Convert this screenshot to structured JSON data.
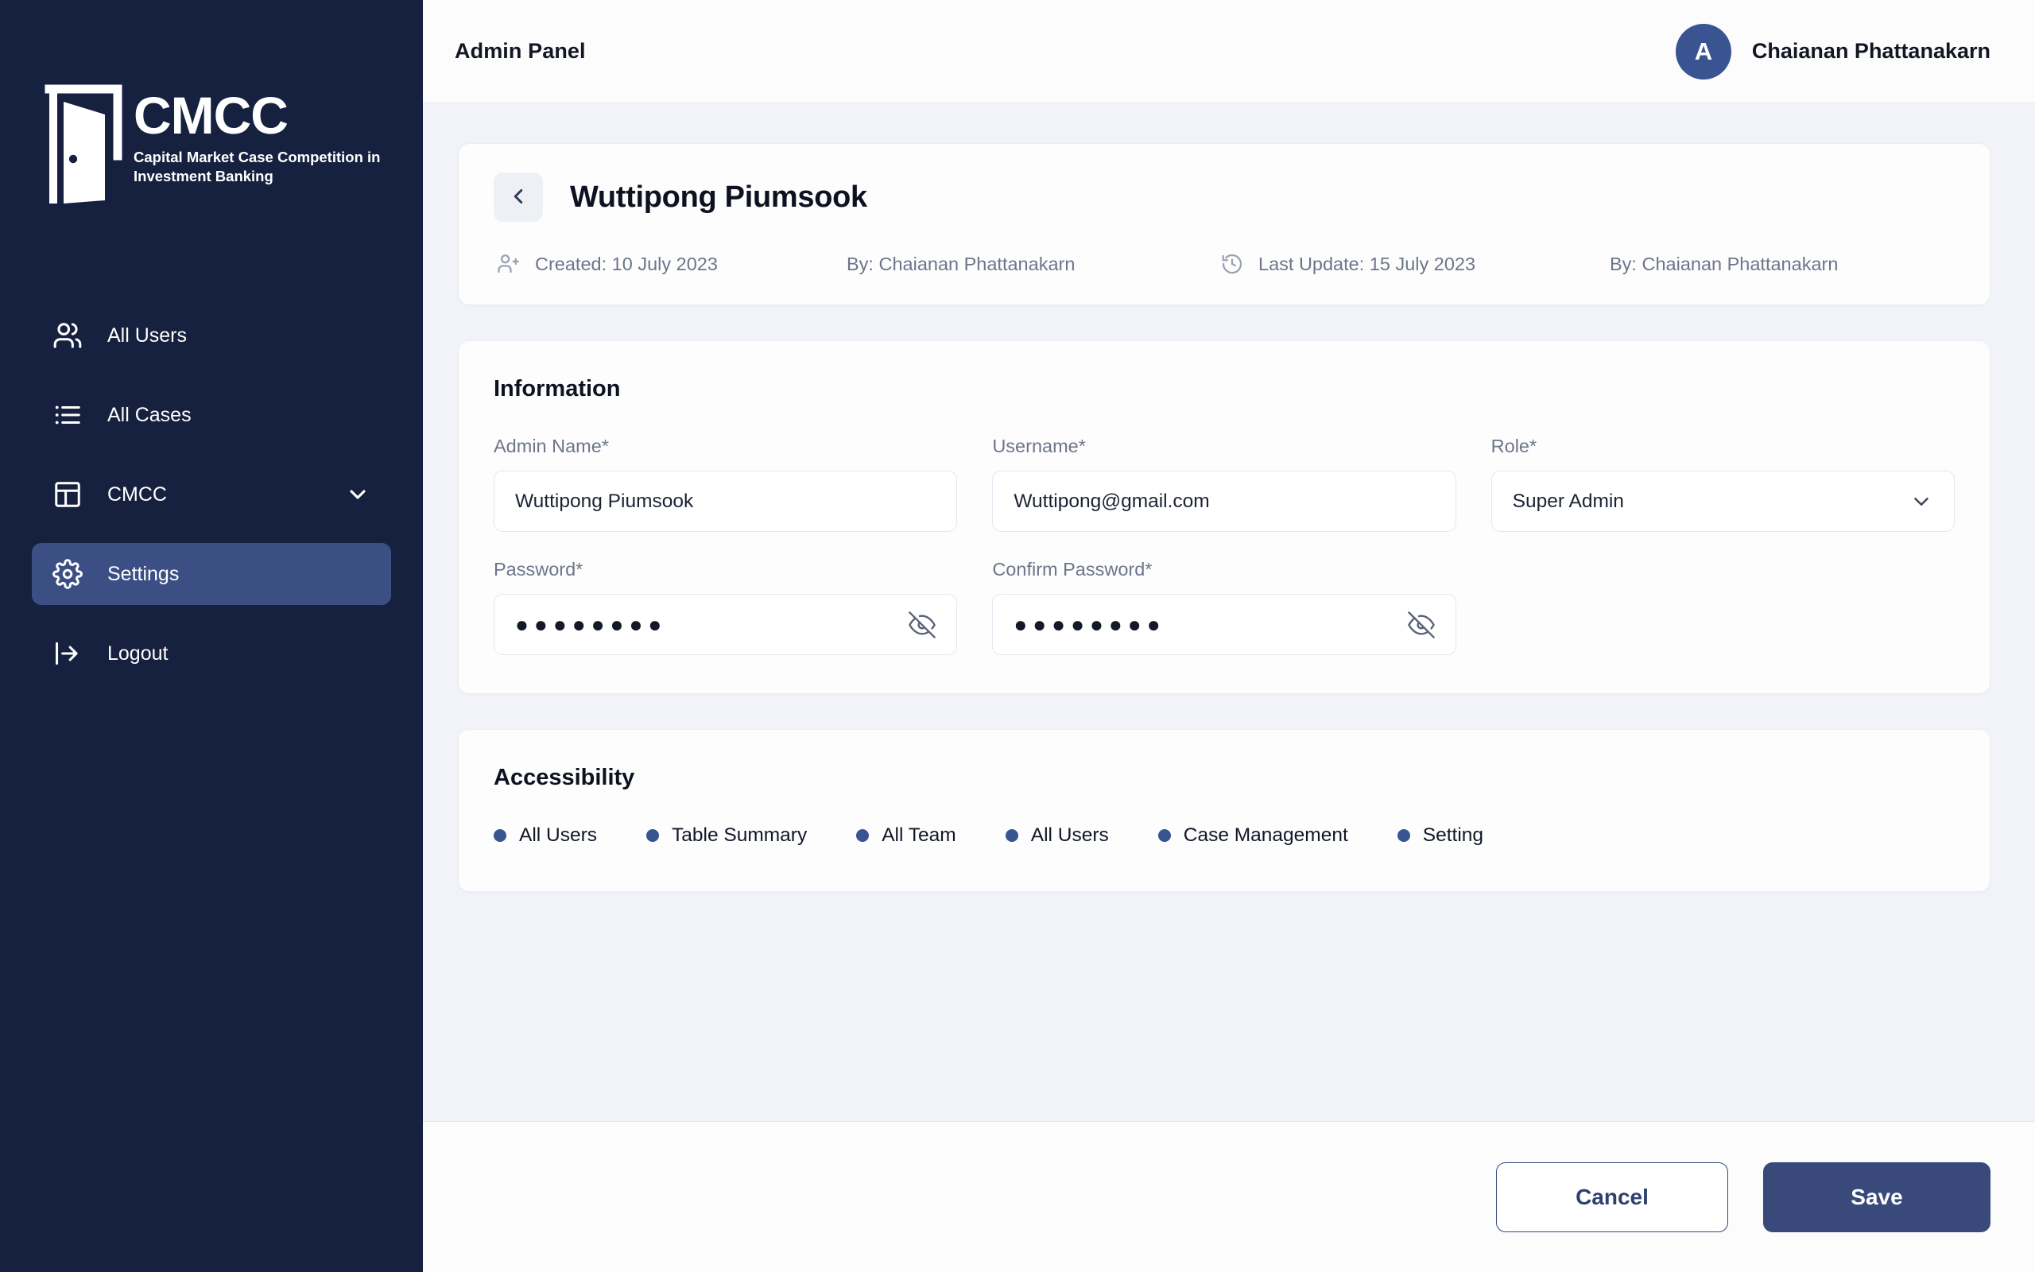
{
  "sidebar": {
    "logo": {
      "icon": "open-door-icon",
      "title": "CMCC",
      "subtitle": "Capital Market Case Competition in Investment Banking"
    },
    "items": [
      {
        "label": "All Users",
        "icon": "users-icon",
        "active": false,
        "has_chevron": false
      },
      {
        "label": "All Cases",
        "icon": "list-icon",
        "active": false,
        "has_chevron": false
      },
      {
        "label": "CMCC",
        "icon": "layout-icon",
        "active": false,
        "has_chevron": true
      },
      {
        "label": "Settings",
        "icon": "gear-icon",
        "active": true,
        "has_chevron": false
      },
      {
        "label": "Logout",
        "icon": "logout-icon",
        "active": false,
        "has_chevron": false
      }
    ]
  },
  "topbar": {
    "title": "Admin Panel",
    "user_initial": "A",
    "user_name": "Chaianan Phattanakarn"
  },
  "header_card": {
    "back_icon": "chevron-left-icon",
    "record_title": "Wuttipong Piumsook",
    "created_icon": "user-plus-icon",
    "created": "Created: 10 July 2023",
    "created_by": "By: Chaianan Phattanakarn",
    "updated_icon": "history-clock-icon",
    "last_update": "Last Update: 15 July 2023",
    "updated_by": "By: Chaianan Phattanakarn"
  },
  "information": {
    "title": "Information",
    "fields": {
      "admin_name": {
        "label": "Admin Name*",
        "value": "Wuttipong Piumsook"
      },
      "username": {
        "label": "Username*",
        "value": "Wuttipong@gmail.com"
      },
      "role": {
        "label": "Role*",
        "value": "Super Admin",
        "icon": "chevron-down-icon"
      },
      "password": {
        "label": "Password*",
        "value": "●●●●●●●●",
        "icon": "eye-off-icon"
      },
      "confirm_password": {
        "label": "Confirm Password*",
        "value": "●●●●●●●●",
        "icon": "eye-off-icon"
      }
    }
  },
  "accessibility": {
    "title": "Accessibility",
    "items": [
      {
        "label": "All Users"
      },
      {
        "label": "Table Summary"
      },
      {
        "label": "All Team"
      },
      {
        "label": "All Users"
      },
      {
        "label": "Case Management"
      },
      {
        "label": "Setting"
      }
    ]
  },
  "footer": {
    "cancel_label": "Cancel",
    "save_label": "Save"
  },
  "colors": {
    "sidebar_bg": "#16213f",
    "sidebar_active": "#3b4f85",
    "accent": "#39497a",
    "avatar_bg": "#3a5391",
    "page_bg": "#f1f3f9",
    "card_bg": "#fdfdfe",
    "dot": "#3a5391"
  }
}
